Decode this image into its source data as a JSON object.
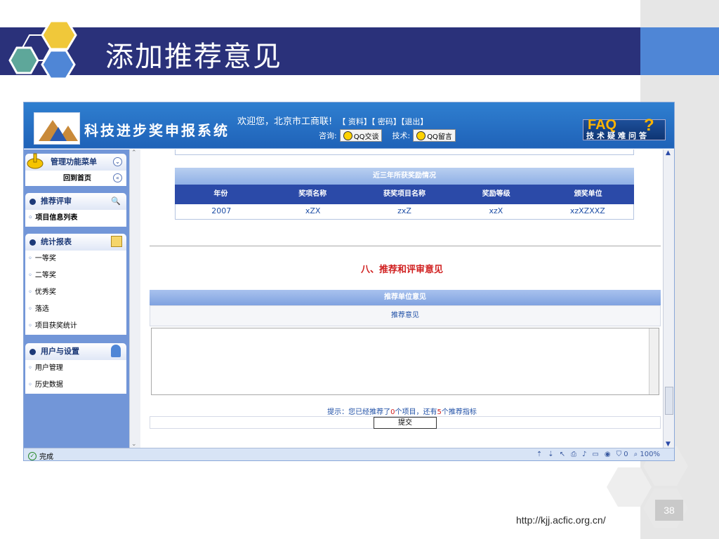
{
  "slide": {
    "title": "添加推荐意见",
    "url": "http://kjj.acfic.org.cn/",
    "page_number": "38"
  },
  "app": {
    "logo_text": "科技进步奖申报系统",
    "welcome": "欢迎您，北京市工商联!",
    "links": [
      "【 资料】",
      "【 密码】",
      "【退出】"
    ],
    "consult_label": "咨询:",
    "qq_chat": "QQ交谈",
    "tech_label": "技术:",
    "qq_message": "QQ留言",
    "faq_title": "FAQ",
    "faq_sub": "技术疑难问答"
  },
  "sidebar": {
    "menu_title": "管理功能菜单",
    "home": "回到首页",
    "groups": [
      {
        "title": "推荐评审",
        "items": [
          "项目信息列表"
        ]
      },
      {
        "title": "统计报表",
        "items": [
          "一等奖",
          "二等奖",
          "优秀奖",
          "落选",
          "项目获奖统计"
        ]
      },
      {
        "title": "用户与设置",
        "items": [
          "用户管理",
          "历史数据"
        ]
      }
    ]
  },
  "awards": {
    "title": "近三年所获奖励情况",
    "columns": [
      "年份",
      "奖项名称",
      "获奖项目名称",
      "奖励等级",
      "颁奖单位"
    ],
    "rows": [
      [
        "2007",
        "xZX",
        "zxZ",
        "xzX",
        "xzXZXXZ"
      ]
    ]
  },
  "section": {
    "title": "八、推荐和评审意见",
    "rec_bar": "推荐单位意见",
    "rec_sub": "推荐意见",
    "hint_prefix": "提示：您已经推荐了",
    "hint_count1": "0",
    "hint_mid": "个项目，还有",
    "hint_count2": "5",
    "hint_suffix": "个推荐指标",
    "submit": "提交"
  },
  "status": {
    "left": "完成",
    "zoom": "100%",
    "count": "0"
  }
}
